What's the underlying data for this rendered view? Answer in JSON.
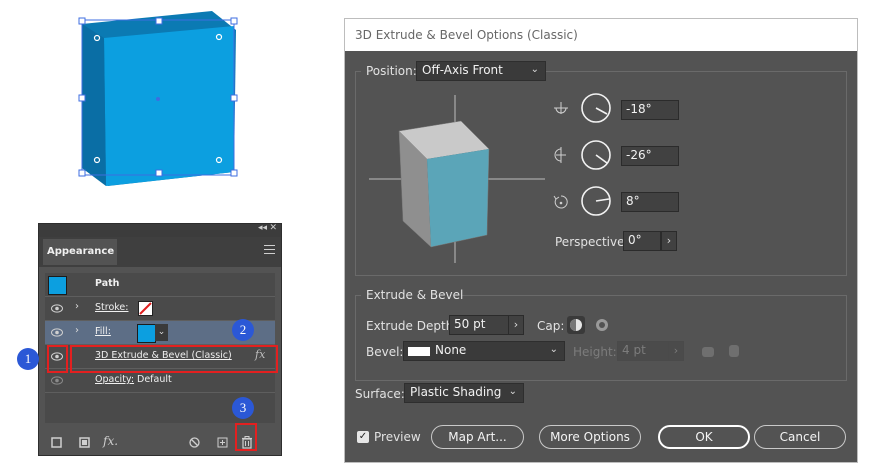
{
  "appearance_panel": {
    "tab_label": "Appearance",
    "object_type": "Path",
    "rows": [
      {
        "label": "Stroke:"
      },
      {
        "label": "Fill:"
      },
      {
        "label": "3D Extrude & Bevel (Classic)",
        "fx": "fx"
      },
      {
        "label": "Opacity:",
        "value": "Default"
      }
    ],
    "bottom_fx": "fx."
  },
  "badges": [
    "1",
    "2",
    "3"
  ],
  "dialog": {
    "title": "3D Extrude & Bevel Options (Classic)",
    "position_label": "Position:",
    "position_value": "Off-Axis Front",
    "rot_x": "-18°",
    "rot_y": "-26°",
    "rot_z": "8°",
    "perspective_label": "Perspective:",
    "perspective_value": "0°",
    "extrude_section_label": "Extrude & Bevel",
    "extrude_depth_label": "Extrude Depth:",
    "extrude_depth_value": "50 pt",
    "cap_label": "Cap:",
    "bevel_label": "Bevel:",
    "bevel_value": "None",
    "height_label": "Height:",
    "height_value": "4 pt",
    "surface_label": "Surface:",
    "surface_value": "Plastic Shading",
    "preview_label": "Preview",
    "preview_checked": true,
    "buttons": {
      "map_art": "Map Art...",
      "more_options": "More Options",
      "ok": "OK",
      "cancel": "Cancel"
    }
  },
  "colors": {
    "fill": "#0c9fe0",
    "cube_front": "#5ba5b8",
    "dialog_bg": "#535353",
    "highlight": "#e32020",
    "badge": "#2b58d6"
  }
}
